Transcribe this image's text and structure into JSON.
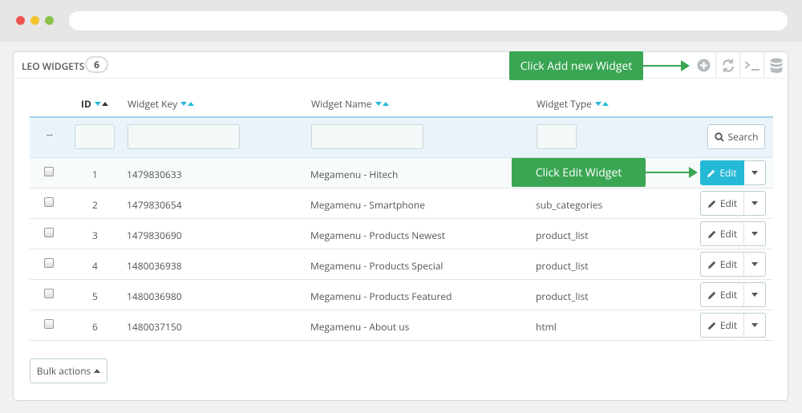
{
  "panel": {
    "title": "LEO WIDGETS",
    "count": "6"
  },
  "toolbar": {
    "icons": [
      "add-circle-icon",
      "refresh-icon",
      "terminal-icon",
      "database-icon"
    ]
  },
  "callouts": {
    "add": "Click Add new Widget",
    "edit": "Click Edit Widget"
  },
  "table": {
    "columns": {
      "id": "ID",
      "key": "Widget Key",
      "name": "Widget Name",
      "type": "Widget Type"
    },
    "filter_dash": "--",
    "search_label": "Search",
    "rows": [
      {
        "id": "1",
        "key": "1479830633",
        "name": "Megamenu - Hitech",
        "type": ""
      },
      {
        "id": "2",
        "key": "1479830654",
        "name": "Megamenu - Smartphone",
        "type": "sub_categories"
      },
      {
        "id": "3",
        "key": "1479830690",
        "name": "Megamenu - Products Newest",
        "type": "product_list"
      },
      {
        "id": "4",
        "key": "1480036938",
        "name": "Megamenu - Products Special",
        "type": "product_list"
      },
      {
        "id": "5",
        "key": "1480036980",
        "name": "Megamenu - Products Featured",
        "type": "product_list"
      },
      {
        "id": "6",
        "key": "1480037150",
        "name": "Megamenu - About us",
        "type": "html"
      }
    ],
    "edit_label": "Edit"
  },
  "bulk_label": "Bulk actions",
  "colors": {
    "accent": "#25b9d7",
    "callout": "#3aa653"
  }
}
